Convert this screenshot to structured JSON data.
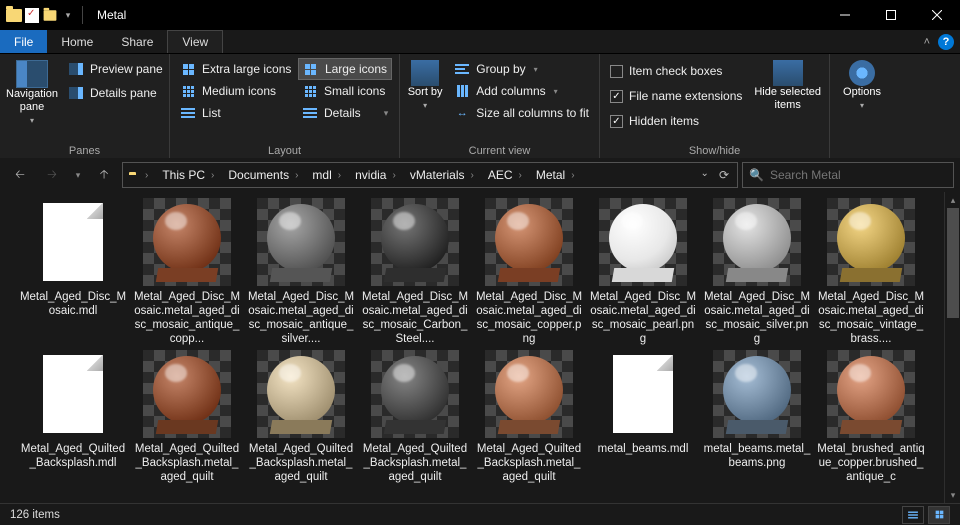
{
  "title": "Metal",
  "menus": {
    "file": "File",
    "home": "Home",
    "share": "Share",
    "view": "View"
  },
  "ribbon": {
    "panes": {
      "nav": "Navigation pane",
      "preview": "Preview pane",
      "details": "Details pane",
      "group": "Panes"
    },
    "layout": {
      "xl": "Extra large icons",
      "lg": "Large icons",
      "md": "Medium icons",
      "sm": "Small icons",
      "list": "List",
      "det": "Details",
      "group": "Layout"
    },
    "current": {
      "sort": "Sort by",
      "groupby": "Group by",
      "addcols": "Add columns",
      "sizeall": "Size all columns to fit",
      "group": "Current view"
    },
    "showhide": {
      "chk": "Item check boxes",
      "ext": "File name extensions",
      "hidden": "Hidden items",
      "hidesel": "Hide selected items",
      "group": "Show/hide"
    },
    "options": "Options"
  },
  "breadcrumbs": [
    "This PC",
    "Documents",
    "mdl",
    "nvidia",
    "vMaterials",
    "AEC",
    "Metal"
  ],
  "search_placeholder": "Search Metal",
  "items": [
    {
      "name": "Metal_Aged_Disc_Mosaic.mdl",
      "kind": "file"
    },
    {
      "name": "Metal_Aged_Disc_Mosaic.metal_aged_disc_mosaic_antique_copp...",
      "kind": "sphere",
      "ball": "#8a4a2e",
      "base": "#7a3e24"
    },
    {
      "name": "Metal_Aged_Disc_Mosaic.metal_aged_disc_mosaic_antique_silver....",
      "kind": "sphere",
      "ball": "#6a6a6a",
      "base": "#555"
    },
    {
      "name": "Metal_Aged_Disc_Mosaic.metal_aged_disc_mosaic_Carbon_Steel....",
      "kind": "sphere",
      "ball": "#3a3a3a",
      "base": "#2e2e2e"
    },
    {
      "name": "Metal_Aged_Disc_Mosaic.metal_aged_disc_mosaic_copper.png",
      "kind": "sphere",
      "ball": "#9a5a3a",
      "base": "#7a3e24"
    },
    {
      "name": "Metal_Aged_Disc_Mosaic.metal_aged_disc_mosaic_pearl.png",
      "kind": "sphere",
      "ball": "#e8e8e8",
      "base": "#d8d8d8"
    },
    {
      "name": "Metal_Aged_Disc_Mosaic.metal_aged_disc_mosaic_silver.png",
      "kind": "sphere",
      "ball": "#a8a8a8",
      "base": "#888"
    },
    {
      "name": "Metal_Aged_Disc_Mosaic.metal_aged_disc_mosaic_vintage_brass....",
      "kind": "sphere",
      "ball": "#b89a4a",
      "base": "#8a7030"
    },
    {
      "name": "Metal_Aged_Quilted_Backsplash.mdl",
      "kind": "file"
    },
    {
      "name": "Metal_Aged_Quilted_Backsplash.metal_aged_quilt",
      "kind": "sphere",
      "ball": "#8a4a2e",
      "base": "#6a3820"
    },
    {
      "name": "Metal_Aged_Quilted_Backsplash.metal_aged_quilt",
      "kind": "sphere",
      "ball": "#b8a888",
      "base": "#8a7a5a"
    },
    {
      "name": "Metal_Aged_Quilted_Backsplash.metal_aged_quilt",
      "kind": "sphere",
      "ball": "#4a4a4a",
      "base": "#333"
    },
    {
      "name": "Metal_Aged_Quilted_Backsplash.metal_aged_quilt",
      "kind": "sphere",
      "ball": "#a86a4a",
      "base": "#7a4a30"
    },
    {
      "name": "metal_beams.mdl",
      "kind": "file"
    },
    {
      "name": "metal_beams.metal_beams.png",
      "kind": "sphere",
      "ball": "#6a829a",
      "base": "#4a5a6a"
    },
    {
      "name": "Metal_brushed_antique_copper.brushed_antique_c",
      "kind": "sphere",
      "ball": "#a8684a",
      "base": "#7a4a30"
    }
  ],
  "status": "126 items"
}
